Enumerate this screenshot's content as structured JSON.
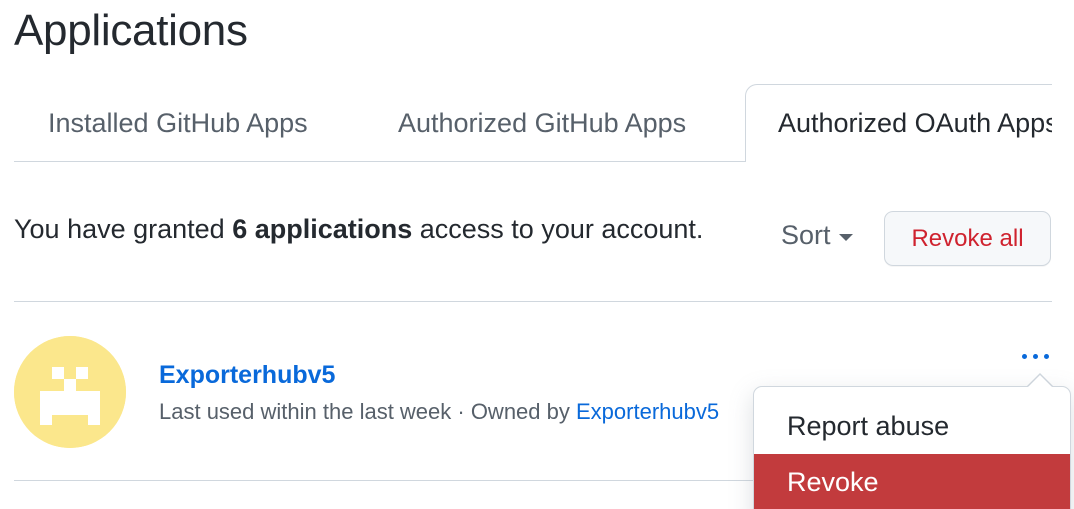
{
  "page": {
    "title": "Applications"
  },
  "tabs": [
    {
      "label": "Installed GitHub Apps",
      "selected": false
    },
    {
      "label": "Authorized GitHub Apps",
      "selected": false
    },
    {
      "label": "Authorized OAuth Apps",
      "selected": true
    }
  ],
  "summary": {
    "prefix": "You have granted ",
    "count_text": "6 applications",
    "suffix": " access to your account."
  },
  "toolbar": {
    "sort_label": "Sort",
    "revoke_all_label": "Revoke all"
  },
  "apps": [
    {
      "name": "Exporterhubv5",
      "meta_prefix": "Last used within the last week · Owned by ",
      "owner": "Exporterhubv5",
      "avatar_color": "#fbe78c"
    }
  ],
  "menu": {
    "report_label": "Report abuse",
    "revoke_label": "Revoke"
  },
  "colors": {
    "link": "#0969da",
    "danger": "#cf222e",
    "danger_bg": "#c23b3d",
    "muted": "#57606a",
    "border": "#d0d7de"
  }
}
